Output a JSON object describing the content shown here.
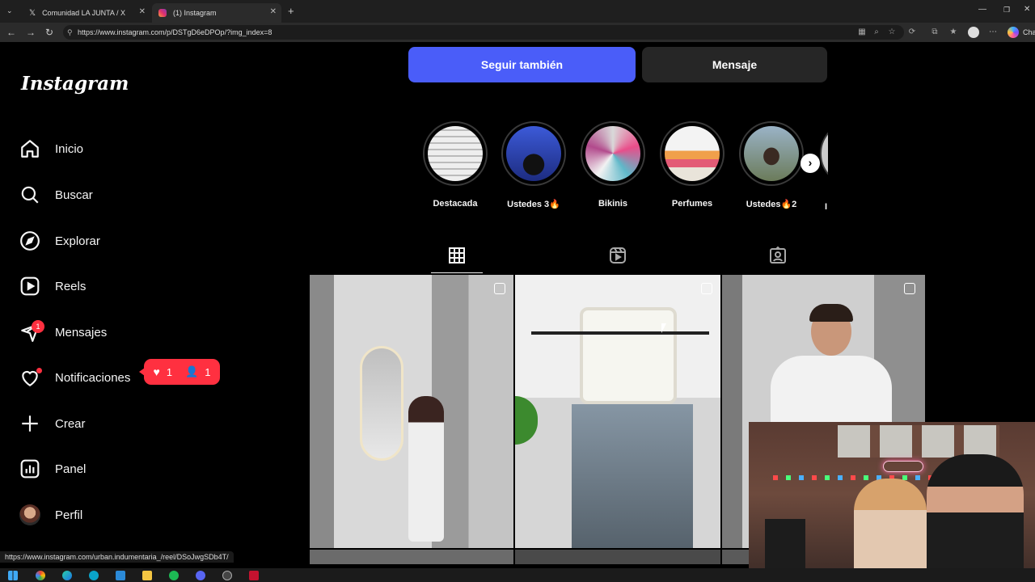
{
  "browser": {
    "tabs": [
      {
        "title": "Comunidad LA JUNTA / X",
        "active": false
      },
      {
        "title": "(1) Instagram",
        "active": true
      }
    ],
    "url": "https://www.instagram.com/p/DSTgD6eDPOp/?img_index=8",
    "profile_label": "Cha",
    "status_url": "https://www.instagram.com/urban.indumentaria_/reel/DSoJwgSDb4T/"
  },
  "sidebar": {
    "logo": "Instagram",
    "items": [
      {
        "label": "Inicio",
        "icon": "home-icon"
      },
      {
        "label": "Buscar",
        "icon": "search-icon"
      },
      {
        "label": "Explorar",
        "icon": "compass-icon"
      },
      {
        "label": "Reels",
        "icon": "reels-icon"
      },
      {
        "label": "Mensajes",
        "icon": "messenger-icon",
        "badge": "1"
      },
      {
        "label": "Notificaciones",
        "icon": "heart-icon"
      },
      {
        "label": "Crear",
        "icon": "plus-icon"
      },
      {
        "label": "Panel",
        "icon": "chart-icon"
      },
      {
        "label": "Perfil",
        "icon": "avatar"
      }
    ],
    "notification_pill": {
      "likes": "1",
      "follows": "1"
    }
  },
  "profile": {
    "follow_back_label": "Seguir también",
    "message_label": "Mensaje",
    "highlights": [
      {
        "label": "Destacada"
      },
      {
        "label": "Ustedes 3🔥"
      },
      {
        "label": "Bikinis"
      },
      {
        "label": "Perfumes"
      },
      {
        "label": "Ustedes🔥2"
      },
      {
        "label": "I"
      }
    ],
    "tabs": [
      "posts-grid-icon",
      "reels-tab-icon",
      "tagged-icon"
    ]
  },
  "colors": {
    "accent_blue": "#4a5df9",
    "badge_red": "#ff3040",
    "secondary_button": "#262626"
  }
}
